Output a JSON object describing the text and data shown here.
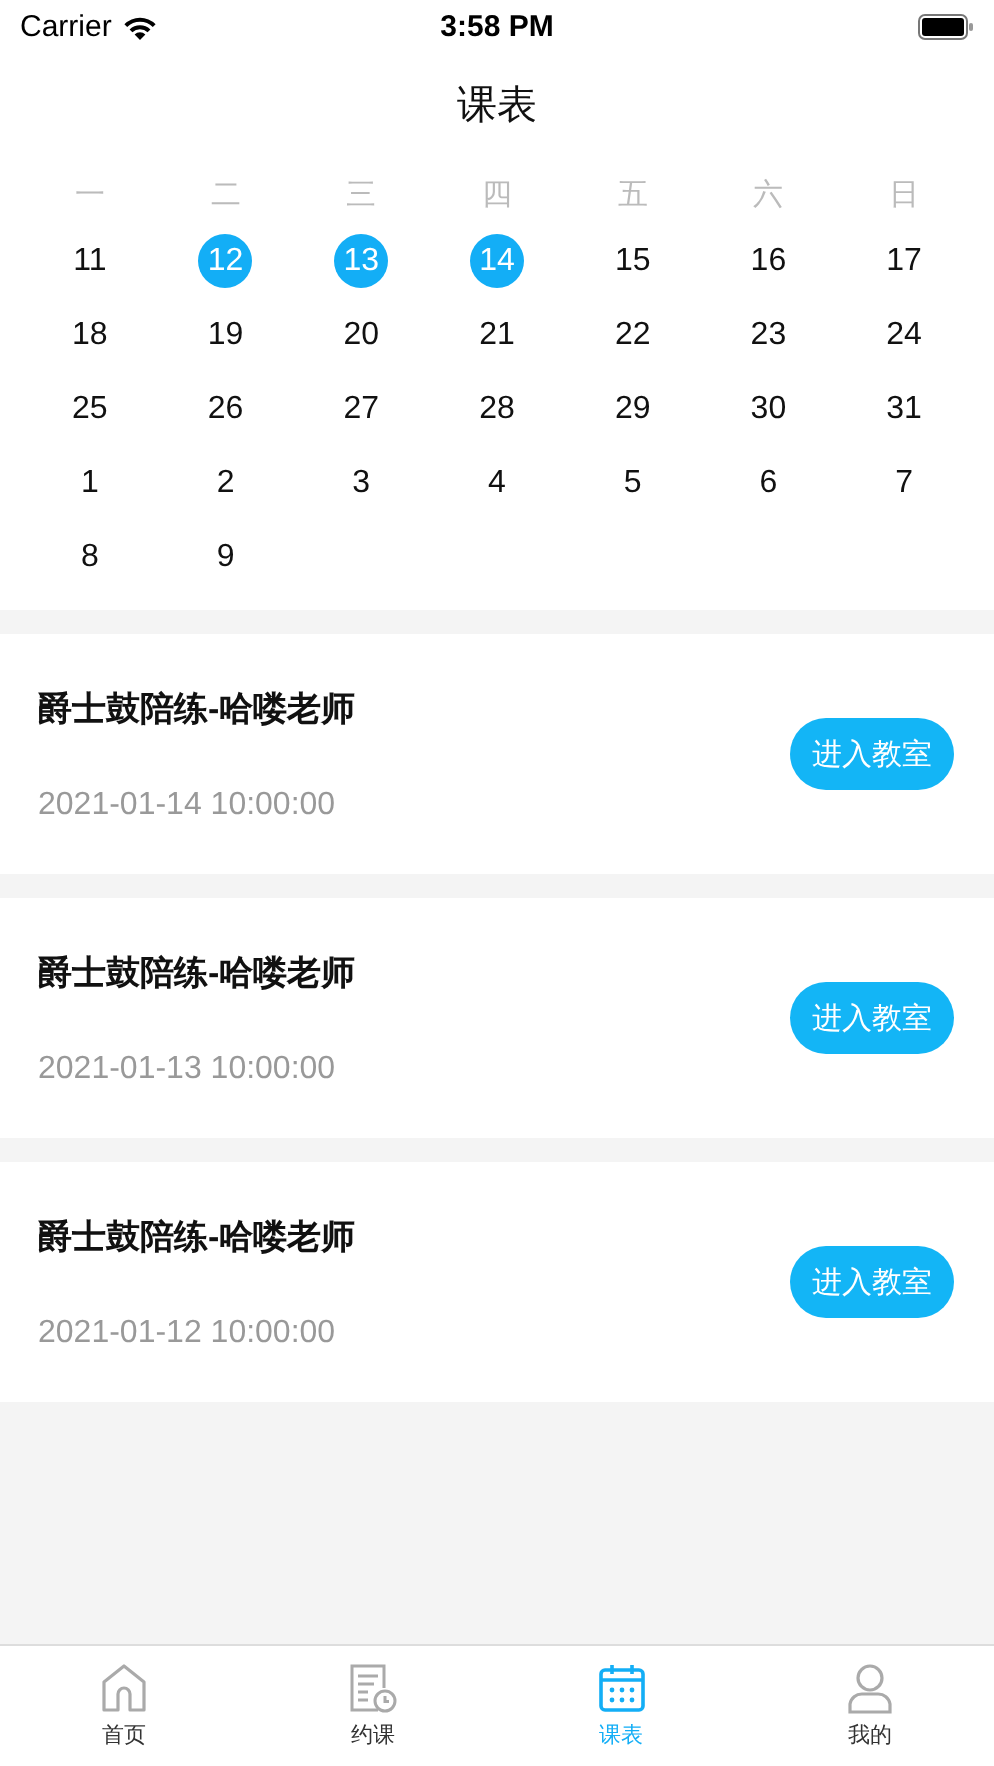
{
  "status_bar": {
    "carrier": "Carrier",
    "time": "3:58 PM"
  },
  "title": "课表",
  "calendar": {
    "weekdays": [
      "一",
      "二",
      "三",
      "四",
      "五",
      "六",
      "日"
    ],
    "weeks": [
      [
        {
          "day": "11",
          "selected": false
        },
        {
          "day": "12",
          "selected": true
        },
        {
          "day": "13",
          "selected": true
        },
        {
          "day": "14",
          "selected": true
        },
        {
          "day": "15",
          "selected": false
        },
        {
          "day": "16",
          "selected": false
        },
        {
          "day": "17",
          "selected": false
        }
      ],
      [
        {
          "day": "18",
          "selected": false
        },
        {
          "day": "19",
          "selected": false
        },
        {
          "day": "20",
          "selected": false
        },
        {
          "day": "21",
          "selected": false
        },
        {
          "day": "22",
          "selected": false
        },
        {
          "day": "23",
          "selected": false
        },
        {
          "day": "24",
          "selected": false
        }
      ],
      [
        {
          "day": "25",
          "selected": false
        },
        {
          "day": "26",
          "selected": false
        },
        {
          "day": "27",
          "selected": false
        },
        {
          "day": "28",
          "selected": false
        },
        {
          "day": "29",
          "selected": false
        },
        {
          "day": "30",
          "selected": false
        },
        {
          "day": "31",
          "selected": false
        }
      ],
      [
        {
          "day": "1",
          "selected": false
        },
        {
          "day": "2",
          "selected": false
        },
        {
          "day": "3",
          "selected": false
        },
        {
          "day": "4",
          "selected": false
        },
        {
          "day": "5",
          "selected": false
        },
        {
          "day": "6",
          "selected": false
        },
        {
          "day": "7",
          "selected": false
        }
      ],
      [
        {
          "day": "8",
          "selected": false
        },
        {
          "day": "9",
          "selected": false
        }
      ]
    ]
  },
  "lessons": [
    {
      "title": "爵士鼓陪练-哈喽老师",
      "time": "2021-01-14 10:00:00",
      "button": "进入教室"
    },
    {
      "title": "爵士鼓陪练-哈喽老师",
      "time": "2021-01-13 10:00:00",
      "button": "进入教室"
    },
    {
      "title": "爵士鼓陪练-哈喽老师",
      "time": "2021-01-12 10:00:00",
      "button": "进入教室"
    }
  ],
  "tab_bar": [
    {
      "kind": "home",
      "label": "首页",
      "selected": false
    },
    {
      "kind": "booking",
      "label": "约课",
      "selected": false
    },
    {
      "kind": "schedule",
      "label": "课表",
      "selected": true
    },
    {
      "kind": "profile",
      "label": "我的",
      "selected": false
    }
  ]
}
